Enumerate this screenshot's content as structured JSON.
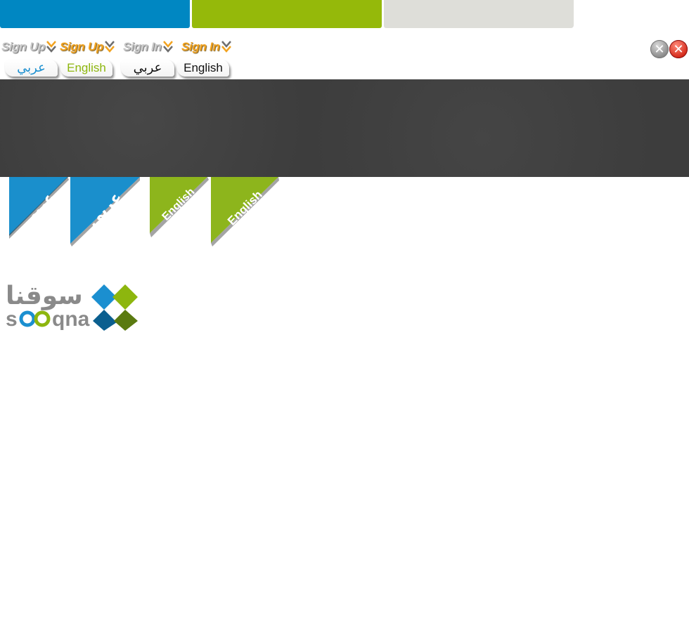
{
  "header": {
    "color_bars": [
      {
        "name": "blue",
        "color": "#0087c2"
      },
      {
        "name": "green",
        "color": "#95b90a"
      },
      {
        "name": "grey",
        "color": "#deded9"
      }
    ],
    "sign_links": [
      {
        "label": "Sign Up",
        "style": "grey"
      },
      {
        "label": "Sign Up",
        "style": "orange"
      },
      {
        "label": "Sign In",
        "style": "grey"
      },
      {
        "label": "Sign In",
        "style": "orange"
      }
    ],
    "language_buttons": [
      {
        "label": "عربي",
        "color": "#1b8fd0"
      },
      {
        "label": "English",
        "color": "#8db60e"
      },
      {
        "label": "عربي",
        "color": "#111111"
      },
      {
        "label": "English",
        "color": "#111111"
      }
    ],
    "close_buttons": [
      {
        "icon": "close-icon",
        "style": "grey"
      },
      {
        "icon": "close-icon",
        "style": "red"
      }
    ]
  },
  "ribbons": [
    {
      "label": "عربي",
      "color": "#1a8fcc"
    },
    {
      "label": "عربي",
      "color": "#1a8fcc"
    },
    {
      "label": "English",
      "color": "#8db51c"
    },
    {
      "label": "English",
      "color": "#8db51c"
    }
  ],
  "logo": {
    "arabic_text": "سوقنا",
    "latin_text": "sooqna",
    "colors": {
      "text": "#8a8a8a",
      "blue": "#1b8fd0",
      "green": "#8db60e",
      "dark_blue": "#0b5f8f",
      "dark_green": "#5a7a10"
    }
  }
}
